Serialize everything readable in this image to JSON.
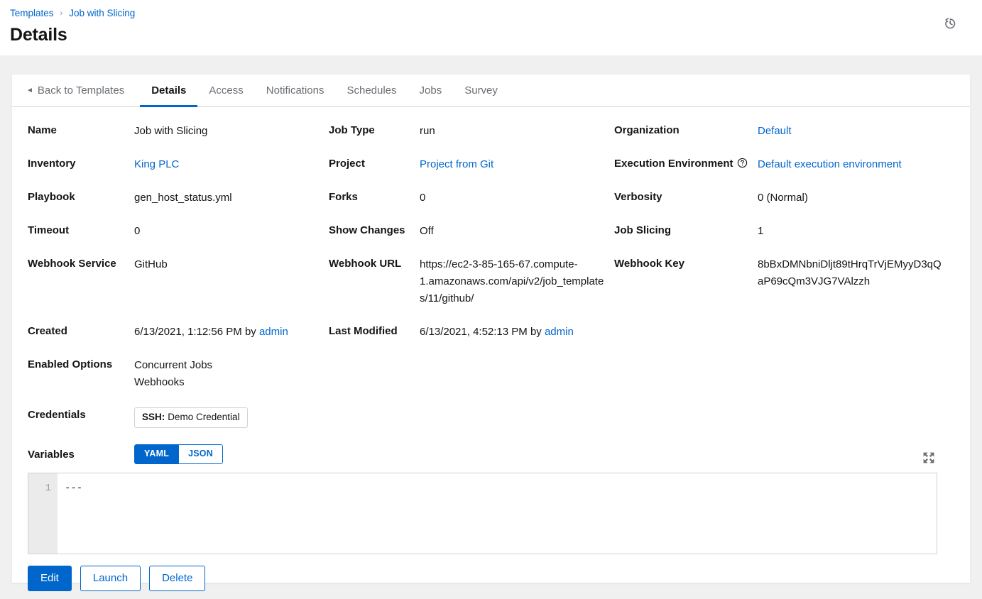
{
  "header": {
    "breadcrumb": [
      {
        "label": "Templates",
        "link": true
      },
      {
        "label": "Job with Slicing",
        "link": true
      }
    ],
    "separator": "›",
    "title": "Details",
    "history_icon": "history-icon"
  },
  "tabs": [
    {
      "label": "Back to Templates",
      "active": false,
      "back": true
    },
    {
      "label": "Details",
      "active": true
    },
    {
      "label": "Access",
      "active": false
    },
    {
      "label": "Notifications",
      "active": false
    },
    {
      "label": "Schedules",
      "active": false
    },
    {
      "label": "Jobs",
      "active": false
    },
    {
      "label": "Survey",
      "active": false
    }
  ],
  "details": {
    "name": {
      "label": "Name",
      "value": "Job with Slicing"
    },
    "job_type": {
      "label": "Job Type",
      "value": "run"
    },
    "organization": {
      "label": "Organization",
      "value": "Default",
      "link": true
    },
    "inventory": {
      "label": "Inventory",
      "value": "King PLC",
      "link": true
    },
    "project": {
      "label": "Project",
      "value": "Project from Git",
      "link": true
    },
    "execution_environment": {
      "label": "Execution Environment",
      "value": "Default execution environment",
      "link": true,
      "help_icon": "question-circle-icon"
    },
    "playbook": {
      "label": "Playbook",
      "value": "gen_host_status.yml"
    },
    "forks": {
      "label": "Forks",
      "value": "0"
    },
    "verbosity": {
      "label": "Verbosity",
      "value": "0 (Normal)"
    },
    "timeout": {
      "label": "Timeout",
      "value": "0"
    },
    "show_changes": {
      "label": "Show Changes",
      "value": "Off"
    },
    "job_slicing": {
      "label": "Job Slicing",
      "value": "1"
    },
    "webhook_service": {
      "label": "Webhook Service",
      "value": "GitHub"
    },
    "webhook_url": {
      "label": "Webhook URL",
      "value": "https://ec2-3-85-165-67.compute-1.amazonaws.com/api/v2/job_templates/11/github/"
    },
    "webhook_key": {
      "label": "Webhook Key",
      "value": "8bBxDMNbniDljt89tHrqTrVjEMyyD3qQaP69cQm3VJG7VAlzzh"
    },
    "created": {
      "label": "Created",
      "value": "6/13/2021, 1:12:56 PM by ",
      "user": "admin"
    },
    "last_modified": {
      "label": "Last Modified",
      "value": "6/13/2021, 4:52:13 PM by ",
      "user": "admin"
    },
    "enabled_options": {
      "label": "Enabled Options",
      "values": [
        "Concurrent Jobs",
        "Webhooks"
      ]
    },
    "credentials": {
      "label": "Credentials",
      "chip_kind": "SSH:",
      "chip_name": "Demo Credential"
    }
  },
  "variables": {
    "label": "Variables",
    "formats": [
      {
        "label": "YAML",
        "active": true
      },
      {
        "label": "JSON",
        "active": false
      }
    ],
    "expand_icon": "expand-arrows-icon",
    "line_number": "1",
    "content": "---"
  },
  "actions": [
    {
      "label": "Edit",
      "variant": "primary"
    },
    {
      "label": "Launch",
      "variant": "secondary"
    },
    {
      "label": "Delete",
      "variant": "secondary"
    }
  ],
  "colors": {
    "accent": "#0066cc",
    "text": "#151515",
    "muted": "#6a6e73",
    "border": "#d2d2d2",
    "page_bg": "#f0f0f0"
  }
}
